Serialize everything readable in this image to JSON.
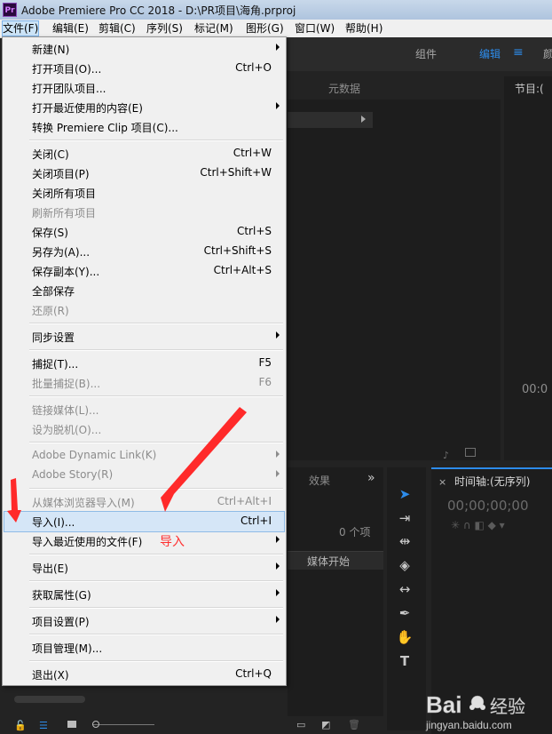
{
  "window": {
    "title": "Adobe Premiere Pro CC 2018 - D:\\PR项目\\海角.prproj",
    "app_icon": "Pr"
  },
  "menubar": [
    "文件(F)",
    "编辑(E)",
    "剪辑(C)",
    "序列(S)",
    "标记(M)",
    "图形(G)",
    "窗口(W)",
    "帮助(H)"
  ],
  "workspaces": {
    "assembly": "组件",
    "editing": "编辑",
    "color": "颜"
  },
  "panels": {
    "metadata_tab": "元数据",
    "program_tab": "节目:(",
    "program_timecode": "00:0",
    "effects_tab": "效果",
    "project_item_count": "0 个项",
    "media_start_col": "媒体开始",
    "timeline_tab": "时间轴:(无序列)",
    "timeline_timecode": "00;00;00;00"
  },
  "file_menu": {
    "items": [
      {
        "label": "新建(N)",
        "shortcut": "",
        "submenu": true,
        "disabled": false
      },
      {
        "label": "打开项目(O)...",
        "shortcut": "Ctrl+O",
        "submenu": false,
        "disabled": false
      },
      {
        "label": "打开团队项目...",
        "shortcut": "",
        "submenu": false,
        "disabled": false
      },
      {
        "label": "打开最近使用的内容(E)",
        "shortcut": "",
        "submenu": true,
        "disabled": false
      },
      {
        "label": "转换 Premiere Clip 项目(C)...",
        "shortcut": "",
        "submenu": false,
        "disabled": false
      },
      {
        "label": "关闭(C)",
        "shortcut": "Ctrl+W",
        "submenu": false,
        "disabled": false
      },
      {
        "label": "关闭项目(P)",
        "shortcut": "Ctrl+Shift+W",
        "submenu": false,
        "disabled": false
      },
      {
        "label": "关闭所有项目",
        "shortcut": "",
        "submenu": false,
        "disabled": false
      },
      {
        "label": "刷新所有项目",
        "shortcut": "",
        "submenu": false,
        "disabled": true
      },
      {
        "label": "保存(S)",
        "shortcut": "Ctrl+S",
        "submenu": false,
        "disabled": false
      },
      {
        "label": "另存为(A)...",
        "shortcut": "Ctrl+Shift+S",
        "submenu": false,
        "disabled": false
      },
      {
        "label": "保存副本(Y)...",
        "shortcut": "Ctrl+Alt+S",
        "submenu": false,
        "disabled": false
      },
      {
        "label": "全部保存",
        "shortcut": "",
        "submenu": false,
        "disabled": false
      },
      {
        "label": "还原(R)",
        "shortcut": "",
        "submenu": false,
        "disabled": true
      },
      {
        "label": "同步设置",
        "shortcut": "",
        "submenu": true,
        "disabled": false
      },
      {
        "label": "捕捉(T)...",
        "shortcut": "F5",
        "submenu": false,
        "disabled": false
      },
      {
        "label": "批量捕捉(B)...",
        "shortcut": "F6",
        "submenu": false,
        "disabled": true
      },
      {
        "label": "链接媒体(L)...",
        "shortcut": "",
        "submenu": false,
        "disabled": true
      },
      {
        "label": "设为脱机(O)...",
        "shortcut": "",
        "submenu": false,
        "disabled": true
      },
      {
        "label": "Adobe Dynamic Link(K)",
        "shortcut": "",
        "submenu": true,
        "disabled": true
      },
      {
        "label": "Adobe Story(R)",
        "shortcut": "",
        "submenu": true,
        "disabled": true
      },
      {
        "label": "从媒体浏览器导入(M)",
        "shortcut": "Ctrl+Alt+I",
        "submenu": false,
        "disabled": true
      },
      {
        "label": "导入(I)...",
        "shortcut": "Ctrl+I",
        "submenu": false,
        "disabled": false
      },
      {
        "label": "导入最近使用的文件(F)",
        "shortcut": "",
        "submenu": true,
        "disabled": false
      },
      {
        "label": "导出(E)",
        "shortcut": "",
        "submenu": true,
        "disabled": false
      },
      {
        "label": "获取属性(G)",
        "shortcut": "",
        "submenu": true,
        "disabled": false
      },
      {
        "label": "项目设置(P)",
        "shortcut": "",
        "submenu": true,
        "disabled": false
      },
      {
        "label": "项目管理(M)...",
        "shortcut": "",
        "submenu": false,
        "disabled": false
      },
      {
        "label": "退出(X)",
        "shortcut": "Ctrl+Q",
        "submenu": false,
        "disabled": false
      }
    ]
  },
  "annotation": {
    "text": "导入",
    "color": "#ff3030"
  },
  "watermark": {
    "brand": "Bai 经验",
    "url": "jingyan.baidu.com"
  },
  "colors": {
    "accent": "#2d8ceb",
    "menu_bg": "#f0f0f0",
    "highlight": "#d5e6f7"
  }
}
